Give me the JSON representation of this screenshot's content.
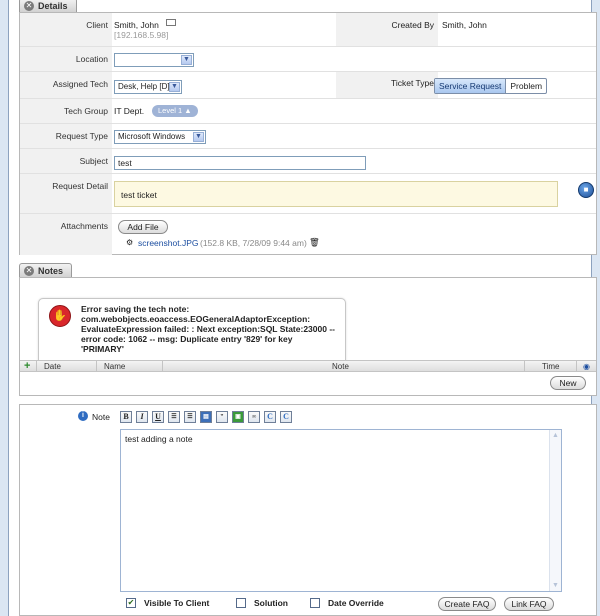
{
  "details": {
    "tab_label": "Details",
    "client_label": "Client",
    "client_name": "Smith, John",
    "client_ip": "[192.168.5.98]",
    "created_by_label": "Created By",
    "created_by_value": "Smith, John",
    "location_label": "Location",
    "location_value": "",
    "assigned_tech_label": "Assigned Tech",
    "assigned_tech_value": "Desk, Help [D]",
    "ticket_type_label": "Ticket Type",
    "ticket_type_options": [
      "Service Request",
      "Problem"
    ],
    "ticket_type_selected": "Service Request",
    "tech_group_label": "Tech Group",
    "tech_group_value": "IT Dept.",
    "level_label": "Level 1",
    "request_type_label": "Request Type",
    "request_type_value": "Microsoft Windows",
    "subject_label": "Subject",
    "subject_value": "test",
    "request_detail_label": "Request Detail",
    "request_detail_value": "test ticket",
    "attachments_label": "Attachments",
    "add_file_label": "Add File",
    "attachment_name": "screenshot.JPG",
    "attachment_meta": "(152.8 KB, 7/28/09 9:44 am)"
  },
  "notes": {
    "tab_label": "Notes",
    "error_lines": [
      "Error saving the tech note:",
      "com.webobjects.eoaccess.EOGeneralAdaptorException:",
      "EvaluateExpression failed: : Next exception:SQL State:23000 --",
      "error code: 1062 -- msg: Duplicate entry '829' for key",
      "'PRIMARY'"
    ],
    "columns": [
      "Date",
      "Name",
      "Note",
      "Time"
    ],
    "new_label": "New"
  },
  "note_editor": {
    "label": "Note",
    "toolbar": [
      "B",
      "I",
      "U"
    ],
    "text": "test adding a note",
    "visible_to_client_label": "Visible To Client",
    "visible_to_client_checked": true,
    "solution_label": "Solution",
    "date_override_label": "Date Override",
    "create_faq_label": "Create FAQ",
    "link_faq_label": "Link FAQ"
  },
  "colors": {
    "accent": "#a9c7ef",
    "error": "#d9272b",
    "detail_bg": "#fdf9e2"
  }
}
